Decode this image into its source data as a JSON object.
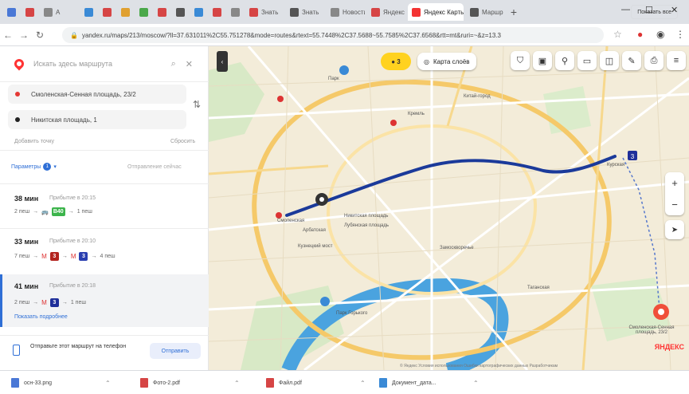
{
  "browser": {
    "tabs": [
      {
        "label": "",
        "color": "#4a78d6"
      },
      {
        "label": "",
        "color": "#d64545"
      },
      {
        "label": "A",
        "color": "#888888"
      },
      {
        "label": "",
        "color": "#3a8ad6"
      },
      {
        "label": "",
        "color": "#d64545"
      },
      {
        "label": "",
        "color": "#e0a030"
      },
      {
        "label": "",
        "color": "#4aa84a"
      },
      {
        "label": "",
        "color": "#d64545"
      },
      {
        "label": "",
        "color": "#555555"
      },
      {
        "label": "",
        "color": "#3a8ad6"
      },
      {
        "label": "",
        "color": "#d64545"
      },
      {
        "label": "",
        "color": "#888888"
      },
      {
        "label": "Знать",
        "color": "#d64545"
      },
      {
        "label": "Знать",
        "color": "#555555"
      },
      {
        "label": "Новости",
        "color": "#888888"
      },
      {
        "label": "Яндекс",
        "color": "#d64545"
      },
      {
        "label": "Яндекс Карты",
        "color": "#f33333",
        "active": true
      },
      {
        "label": "Маршр",
        "color": "#555555"
      }
    ],
    "address": "yandex.ru/maps/213/moscow/?ll=37.631011%2C55.751278&mode=routes&rtext=55.7448%2C37.5688~55.7585%2C37.6568&rtt=mt&ruri=~&z=13.3"
  },
  "panel": {
    "search_placeholder": "Искать здесь маршрута",
    "from": "Смоленская-Сенная площадь, 23/2",
    "to": "Никитская площадь, 1",
    "add_point": "Добавить точку",
    "reset": "Сбросить",
    "params": "Параметры",
    "params_count": "1",
    "depart_now": "Отправление сейчас",
    "routes": [
      {
        "time": "38 мин",
        "arrive": "Прибытие в 20:15",
        "steps": [
          "2 пеш",
          "→",
          "Bus",
          "B40",
          "→",
          "1 пеш"
        ]
      },
      {
        "time": "33 мин",
        "arrive": "Прибытие в 20:10",
        "steps": [
          "7 пеш",
          "→",
          "M",
          "3",
          "→",
          "M",
          "3",
          "→",
          "4 пеш"
        ]
      },
      {
        "time": "41 мин",
        "arrive": "Прибытие в 20:18",
        "steps": [
          "2 пеш",
          "→",
          "M",
          "3",
          "→",
          "1 пеш"
        ],
        "selected": true,
        "details": "Показать подробнее"
      }
    ],
    "send_text": "Отправьте этот маршрут на телефон",
    "send_button": "Отправить"
  },
  "map": {
    "traffic_label": "3",
    "layers_label": "Карта слоёв",
    "zoom_in": "+",
    "zoom_out": "−",
    "logo": "ЯНДЕКС",
    "copyright": "© Яндекс  Условия использования  Ошибки картографических данных  Разработчикам",
    "labels": [
      {
        "id": "arbat",
        "text": "Арбатская"
      },
      {
        "id": "smol",
        "text": "Смоленская"
      },
      {
        "id": "kremlin",
        "text": "Кремль"
      },
      {
        "id": "kitay",
        "text": "Китай-город"
      },
      {
        "id": "kursk",
        "text": "Курская"
      },
      {
        "id": "taganka",
        "text": "Таганская"
      },
      {
        "id": "park",
        "text": "Парк Горького"
      },
      {
        "id": "zamoskv",
        "text": "Замоскворечье"
      },
      {
        "id": "dest",
        "text": "Смоленская-Сенная площадь, 23/2"
      },
      {
        "id": "start",
        "text": "Никитская площадь"
      },
      {
        "id": "start2",
        "text": "Лубянская площадь"
      },
      {
        "id": "kuznets",
        "text": "Кузнецкий мост"
      },
      {
        "id": "park2",
        "text": "Парк"
      }
    ]
  },
  "downloads": {
    "items": [
      {
        "name": "осн-33.png",
        "color": "#4a78d6"
      },
      {
        "name": "Фото-2.pdf",
        "color": "#d64545"
      },
      {
        "name": "Файл.pdf",
        "color": "#d64545"
      },
      {
        "name": "Документ_дата...",
        "color": "#3a8ad6"
      }
    ],
    "show_all": "Показать все"
  },
  "colors": {
    "route_line": "#1b3a9a",
    "river": "#4aa3df",
    "accent_red": "#f33333",
    "map_bg": "#f3ecd9"
  }
}
